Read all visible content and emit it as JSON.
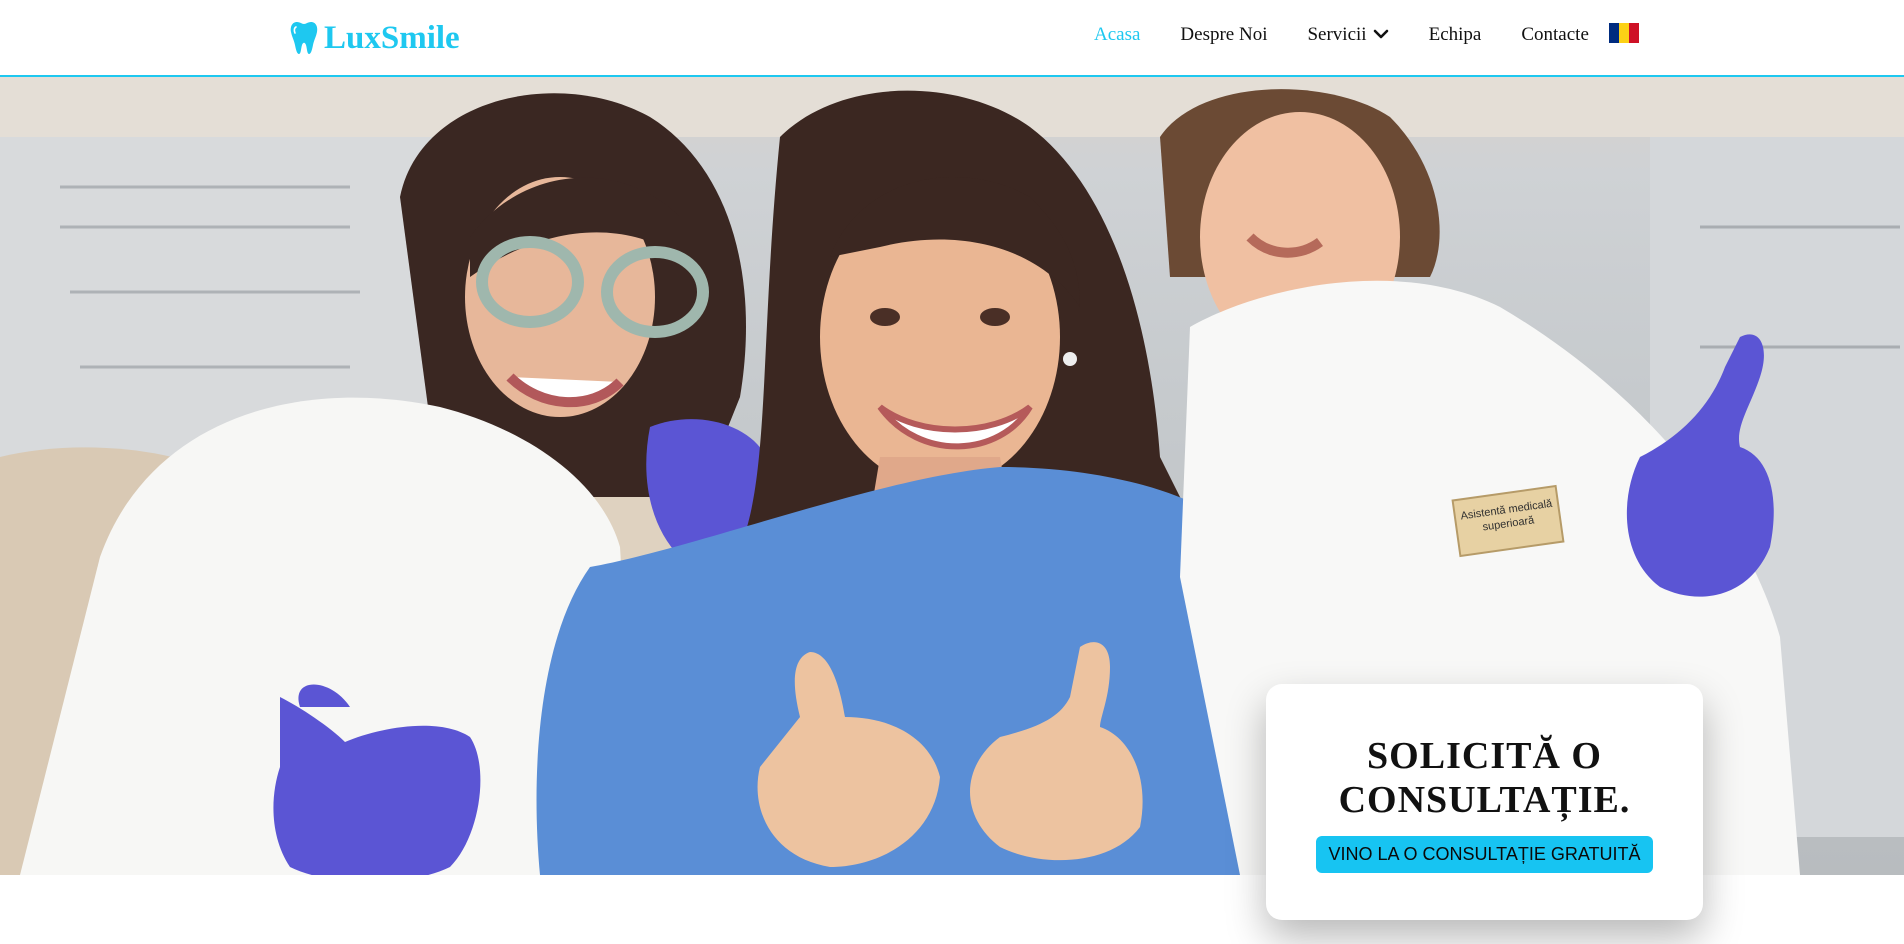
{
  "brand": {
    "name": "LuxSmile",
    "color": "#1ec8f0",
    "icon": "tooth-icon"
  },
  "nav": {
    "items": [
      {
        "label": "Acasa",
        "active": true
      },
      {
        "label": "Despre Noi",
        "active": false
      },
      {
        "label": "Servicii",
        "active": false,
        "dropdown": true
      },
      {
        "label": "Echipa",
        "active": false
      },
      {
        "label": "Contacte",
        "active": false
      }
    ],
    "language_flag": {
      "icon": "romania-flag-icon",
      "colors": [
        "#002b7f",
        "#fcd116",
        "#ce1126"
      ]
    }
  },
  "hero": {
    "image": "three women in a dental clinic smiling and giving thumbs up",
    "badge_text_line1": "Asistentă medicală",
    "badge_text_line2": "superioară",
    "glove_color": "#5b55d4",
    "bib_color": "#5a8ed6"
  },
  "cta": {
    "title_line1": "SOLICITĂ O",
    "title_line2": "CONSULTAȚIE.",
    "button_label": "VINO LA O CONSULTAȚIE GRATUITĂ",
    "button_color": "#17c4f2"
  }
}
